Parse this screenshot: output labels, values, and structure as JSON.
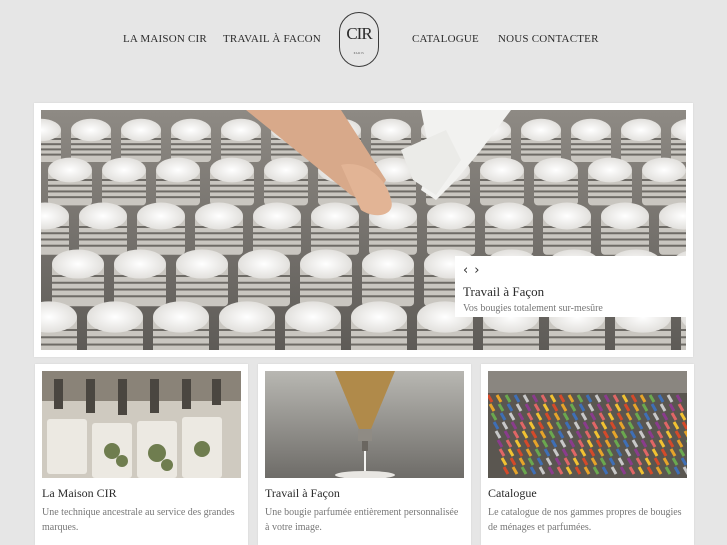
{
  "nav": {
    "items": [
      "LA MAISON CIR",
      "TRAVAIL À FACON",
      "CATALOGUE",
      "NOUS CONTACTER"
    ],
    "logo_text": "CIR",
    "logo_sub": "PARIS"
  },
  "hero": {
    "title": "Travail à Façon",
    "subtitle": "Vos bougies totalement sur-mesûre",
    "prev_icon": "chevron-left-icon",
    "next_icon": "chevron-right-icon"
  },
  "cards": [
    {
      "title": "La Maison CIR",
      "desc": "Une technique ancestrale au service des grandes marques."
    },
    {
      "title": "Travail à Façon",
      "desc": "Une bougie parfumée entièrement personnalisée à votre image."
    },
    {
      "title": "Catalogue",
      "desc": "Le catalogue de nos gammes propres de bougies de ménages et parfumées."
    }
  ],
  "colors": {
    "background": "#e6e6e6",
    "panel": "#ffffff",
    "text": "#2b2b2b",
    "muted": "#777777"
  }
}
